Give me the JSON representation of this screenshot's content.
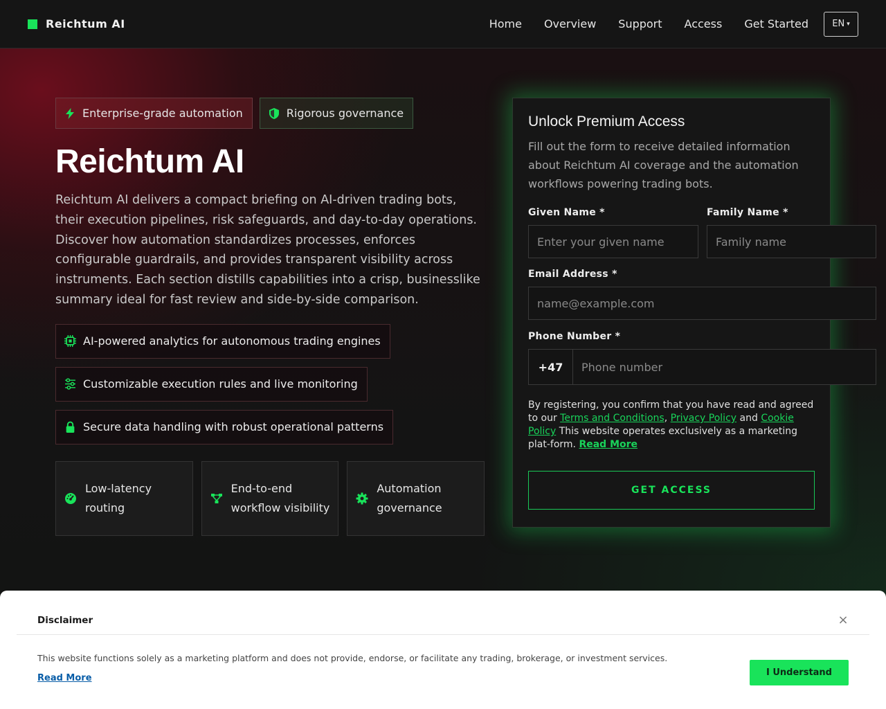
{
  "brand": {
    "name": "Reichtum AI",
    "accent": "#19e35a"
  },
  "nav": {
    "links": [
      "Home",
      "Overview",
      "Support",
      "Access",
      "Get Started"
    ],
    "language": "EN"
  },
  "hero": {
    "badges": [
      {
        "icon": "bolt-icon",
        "label": "Enterprise-grade automation"
      },
      {
        "icon": "shield-icon",
        "label": "Rigorous governance"
      }
    ],
    "title": "Reichtum AI",
    "description": "Reichtum AI delivers a compact briefing on AI-driven trading bots, their execution pipelines, risk safeguards, and day-to-day operations. Discover how automation standardizes processes, enforces configurable guardrails, and provides transparent visibility across instruments. Each section distills capabilities into a crisp, businesslike summary ideal for fast review and side-by-side comparison.",
    "features": [
      {
        "icon": "chip-icon",
        "label": "AI-powered analytics for autonomous trading engines"
      },
      {
        "icon": "sliders-icon",
        "label": "Customizable execution rules and live monitoring"
      },
      {
        "icon": "lock-icon",
        "label": "Secure data handling with robust operational patterns"
      }
    ],
    "cards": [
      {
        "icon": "gauge-icon",
        "label": "Low-latency routing"
      },
      {
        "icon": "workflow-icon",
        "label": "End-to-end workflow visibility"
      },
      {
        "icon": "gear-icon",
        "label": "Automation governance"
      }
    ]
  },
  "form": {
    "title": "Unlock Premium Access",
    "subtitle": "Fill out the form to receive detailed information about Reichtum AI coverage and the automation workflows powering trading bots.",
    "given_name_label": "Given Name *",
    "given_name_placeholder": "Enter your given name",
    "family_name_label": "Family Name *",
    "family_name_placeholder": "Family name",
    "email_label": "Email Address *",
    "email_placeholder": "name@example.com",
    "phone_label": "Phone Number *",
    "phone_code": "+47",
    "phone_placeholder": "Phone number",
    "legal_prefix": "By registering, you confirm that you have read and agreed to our ",
    "terms_link": "Terms and Conditions",
    "comma": ", ",
    "privacy_link": "Privacy Policy",
    "and": " and ",
    "cookie_link": "Cookie Policy",
    "legal_suffix": " This website operates exclusively as a marketing plat-form. ",
    "read_more": "Read More",
    "submit": "GET ACCESS"
  },
  "disclaimer": {
    "title": "Disclaimer",
    "text": "This website functions solely as a marketing platform and does not provide, endorse, or facilitate any trading, brokerage, or investment services.",
    "read_more": "Read More",
    "button": "I Understand",
    "close": "×"
  }
}
